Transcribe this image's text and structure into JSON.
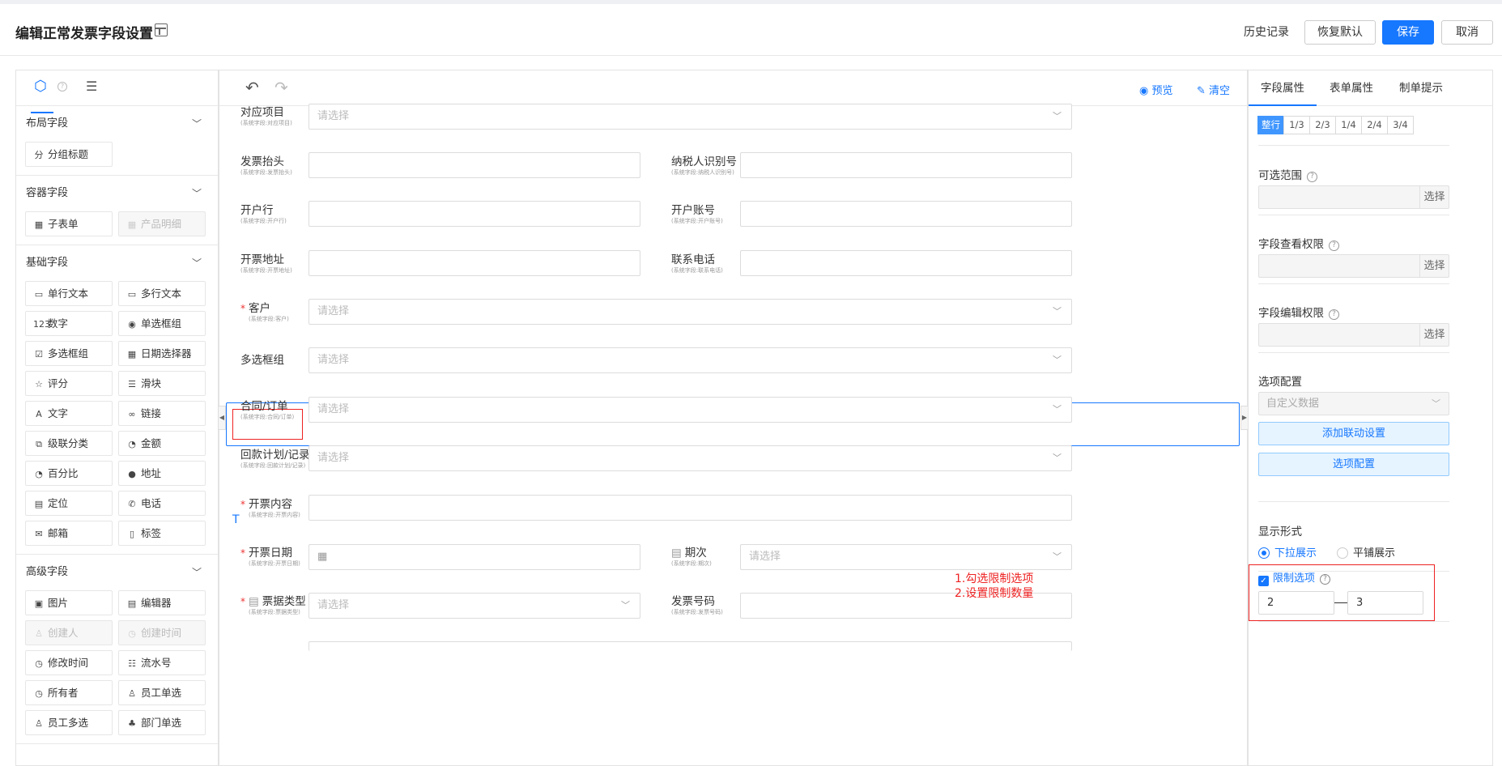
{
  "header": {
    "title": "编辑正常发票字段设置",
    "history": "历史记录",
    "restore": "恢复默认",
    "save": "保存",
    "cancel": "取消"
  },
  "palette": {
    "sections": [
      {
        "title": "布局字段",
        "items": [
          {
            "icon": "分",
            "label": "分组标题",
            "disabled": false
          }
        ]
      },
      {
        "title": "容器字段",
        "items": [
          {
            "icon": "▦",
            "label": "子表单",
            "disabled": false
          },
          {
            "icon": "▦",
            "label": "产品明细",
            "disabled": true
          }
        ]
      },
      {
        "title": "基础字段",
        "items": [
          {
            "icon": "▭",
            "label": "单行文本",
            "disabled": false
          },
          {
            "icon": "▭",
            "label": "多行文本",
            "disabled": false
          },
          {
            "icon": "123",
            "label": "数字",
            "disabled": false
          },
          {
            "icon": "◉",
            "label": "单选框组",
            "disabled": false
          },
          {
            "icon": "☑",
            "label": "多选框组",
            "disabled": false
          },
          {
            "icon": "▦",
            "label": "日期选择器",
            "disabled": false
          },
          {
            "icon": "☆",
            "label": "评分",
            "disabled": false
          },
          {
            "icon": "☰",
            "label": "滑块",
            "disabled": false
          },
          {
            "icon": "A",
            "label": "文字",
            "disabled": false
          },
          {
            "icon": "∞",
            "label": "链接",
            "disabled": false
          },
          {
            "icon": "⧉",
            "label": "级联分类",
            "disabled": false
          },
          {
            "icon": "◔",
            "label": "金额",
            "disabled": false
          },
          {
            "icon": "◔",
            "label": "百分比",
            "disabled": false
          },
          {
            "icon": "●",
            "label": "地址",
            "disabled": false
          },
          {
            "icon": "▤",
            "label": "定位",
            "disabled": false
          },
          {
            "icon": "✆",
            "label": "电话",
            "disabled": false
          },
          {
            "icon": "✉",
            "label": "邮箱",
            "disabled": false
          },
          {
            "icon": "▯",
            "label": "标签",
            "disabled": false
          }
        ]
      },
      {
        "title": "高级字段",
        "items": [
          {
            "icon": "▣",
            "label": "图片",
            "disabled": false
          },
          {
            "icon": "▤",
            "label": "编辑器",
            "disabled": false
          },
          {
            "icon": "♙",
            "label": "创建人",
            "disabled": true
          },
          {
            "icon": "◷",
            "label": "创建时间",
            "disabled": true
          },
          {
            "icon": "◷",
            "label": "修改时间",
            "disabled": false
          },
          {
            "icon": "☷",
            "label": "流水号",
            "disabled": false
          },
          {
            "icon": "◷",
            "label": "所有者",
            "disabled": false
          },
          {
            "icon": "♙",
            "label": "员工单选",
            "disabled": false
          },
          {
            "icon": "♙",
            "label": "员工多选",
            "disabled": false
          },
          {
            "icon": "♣",
            "label": "部门单选",
            "disabled": false
          }
        ]
      }
    ]
  },
  "canvas": {
    "preview": "预览",
    "clear": "清空",
    "rows": [
      {
        "label": "对应项目",
        "sub": "(系统字段:对应项目)",
        "placeholder": "请选择"
      },
      {
        "label": "发票抬头",
        "sub": "(系统字段:发票抬头)",
        "placeholder": ""
      },
      {
        "label": "纳税人识别号",
        "sub": "(系统字段:纳税人识别号)",
        "placeholder": ""
      },
      {
        "label": "开户行",
        "sub": "(系统字段:开户行)",
        "placeholder": ""
      },
      {
        "label": "开户账号",
        "sub": "(系统字段:开户账号)",
        "placeholder": ""
      },
      {
        "label": "开票地址",
        "sub": "(系统字段:开票地址)",
        "placeholder": ""
      },
      {
        "label": "联系电话",
        "sub": "(系统字段:联系电话)",
        "placeholder": ""
      },
      {
        "label": "客户",
        "sub": "(系统字段:客户)",
        "placeholder": "请选择"
      },
      {
        "label": "多选框组",
        "sub": "",
        "placeholder": "请选择"
      },
      {
        "label": "合同/订单",
        "sub": "(系统字段:合同/订单)",
        "placeholder": "请选择"
      },
      {
        "label": "回款计划/记录",
        "sub": "(系统字段:回款计划/记录)",
        "placeholder": "请选择"
      },
      {
        "label": "开票内容",
        "sub": "(系统字段:开票内容)",
        "placeholder": ""
      },
      {
        "label": "开票日期",
        "sub": "(系统字段:开票日期)",
        "placeholder": ""
      },
      {
        "label": "期次",
        "sub": "(系统字段:期次)",
        "placeholder": "请选择"
      },
      {
        "label": "票据类型",
        "sub": "(系统字段:票据类型)",
        "placeholder": "请选择"
      },
      {
        "label": "发票号码",
        "sub": "(系统字段:发票号码)",
        "placeholder": ""
      }
    ],
    "annotation_line1": "1.勾选限制选项",
    "annotation_line2": "2.设置限制数量",
    "cursor": "T"
  },
  "props": {
    "tabs": [
      "字段属性",
      "表单属性",
      "制单提示"
    ],
    "widths": [
      "整行",
      "1/3",
      "2/3",
      "1/4",
      "2/4",
      "3/4"
    ],
    "range_label": "可选范围",
    "view_perm_label": "字段查看权限",
    "edit_perm_label": "字段编辑权限",
    "pick": "选择",
    "options_label": "选项配置",
    "options_source": "自定义数据",
    "add_link_btn": "添加联动设置",
    "options_btn": "选项配置",
    "display_label": "显示形式",
    "display_dropdown": "下拉展示",
    "display_flat": "平铺展示",
    "limit_label": "限制选项",
    "limit_min": "2",
    "limit_max": "3"
  },
  "colors": {
    "accent": "#1677ff",
    "annotation": "#e22222"
  }
}
